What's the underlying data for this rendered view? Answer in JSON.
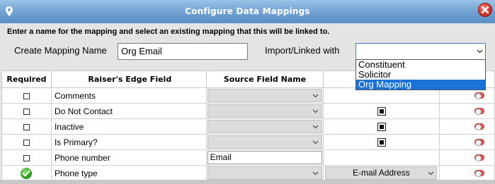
{
  "window": {
    "title": "Configure  Data Mappings"
  },
  "form": {
    "instructions": "Enter a name for the mapping and select an existing mapping that this will be linked to.",
    "name_label": "Create Mapping Name",
    "name_value": "Org Email",
    "link_label": "Import/Linked with",
    "link_value": "",
    "options": [
      "Constituent",
      "Solicitor",
      "Org Mapping"
    ],
    "highlighted_option": "Org Mapping"
  },
  "table": {
    "headers": [
      "Required",
      "Raiser's Edge Field",
      "Source Field Name",
      "",
      ""
    ],
    "rows": [
      {
        "field": "Comments",
        "source": "",
        "link": "",
        "required": "checkbox",
        "linked_check": false
      },
      {
        "field": "Do Not Contact",
        "source": "",
        "link": "",
        "required": "checkbox",
        "linked_check": true
      },
      {
        "field": "Inactive",
        "source": "",
        "link": "",
        "required": "checkbox",
        "linked_check": true
      },
      {
        "field": "Is Primary?",
        "source": "",
        "link": "",
        "required": "checkbox",
        "linked_check": true
      },
      {
        "field": "Phone number",
        "source": "Email",
        "link": "",
        "required": "checkbox",
        "linked_check": false
      },
      {
        "field": "Phone type",
        "source": "",
        "link": "E-mail Address",
        "required": "green-check",
        "linked_check": false
      }
    ]
  },
  "icons": {
    "pin": "map-pin-icon",
    "close": "close-icon",
    "chevron": "chevron-down-icon",
    "toggle": "toggle-switch-icon",
    "required_ok": "green-checkmark-icon"
  },
  "colors": {
    "title_bar": "#6fa0d2",
    "selection": "#1a72d6",
    "close": "#d8352a",
    "toggle": "#e05a5a"
  }
}
